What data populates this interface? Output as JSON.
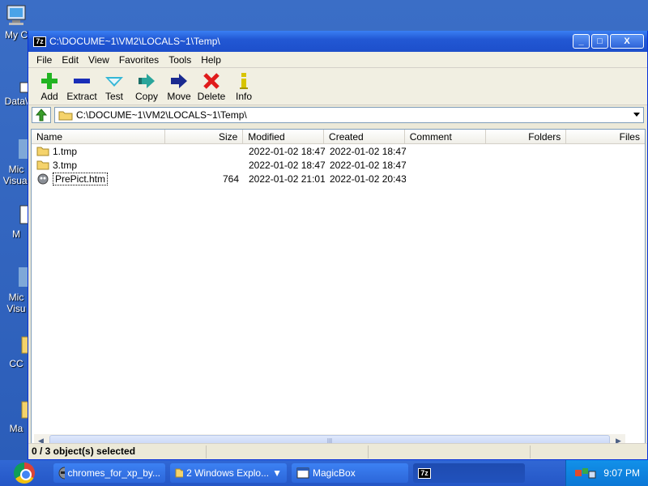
{
  "desktop_icons": [
    {
      "label": "My C"
    },
    {
      "label": "Data\\"
    },
    {
      "label": "Mic"
    },
    {
      "label": "Visual"
    },
    {
      "label": "M"
    },
    {
      "label": "Mic"
    },
    {
      "label": "Visu"
    },
    {
      "label": "CC"
    },
    {
      "label": "Ma"
    }
  ],
  "window": {
    "app_badge": "7z",
    "title": "C:\\DOCUME~1\\VM2\\LOCALS~1\\Temp\\",
    "buttons": {
      "minimize": "_",
      "maximize": "□",
      "close": "X"
    }
  },
  "menu": [
    "File",
    "Edit",
    "View",
    "Favorites",
    "Tools",
    "Help"
  ],
  "toolbar": [
    {
      "label": "Add",
      "icon": "plus-icon",
      "color": "#22b422"
    },
    {
      "label": "Extract",
      "icon": "minus-icon",
      "color": "#1a2eb8"
    },
    {
      "label": "Test",
      "icon": "check-icon",
      "color": "#35b7d6"
    },
    {
      "label": "Copy",
      "icon": "copy-arrow-icon",
      "color": "#2aa59b"
    },
    {
      "label": "Move",
      "icon": "move-arrow-icon",
      "color": "#1a2a90"
    },
    {
      "label": "Delete",
      "icon": "x-icon",
      "color": "#e01b1b"
    },
    {
      "label": "Info",
      "icon": "info-icon",
      "color": "#d8c400"
    }
  ],
  "address": {
    "path": "C:\\DOCUME~1\\VM2\\LOCALS~1\\Temp\\"
  },
  "columns": [
    "Name",
    "Size",
    "Modified",
    "Created",
    "Comment",
    "Folders",
    "Files"
  ],
  "rows": [
    {
      "name": "1.tmp",
      "type": "folder",
      "size": "",
      "modified": "2022-01-02 18:47",
      "created": "2022-01-02 18:47"
    },
    {
      "name": "3.tmp",
      "type": "folder",
      "size": "",
      "modified": "2022-01-02 18:47",
      "created": "2022-01-02 18:47"
    },
    {
      "name": "PrePict.htm",
      "type": "file",
      "size": "764",
      "modified": "2022-01-02 21:01",
      "created": "2022-01-02 20:43"
    }
  ],
  "status": {
    "selection": "0 / 3 object(s) selected"
  },
  "taskbar": {
    "tasks": [
      {
        "label": "chromes_for_xp_by..."
      },
      {
        "label": "2 Windows Explo..."
      },
      {
        "label": "MagicBox"
      },
      {
        "label": "7z"
      }
    ],
    "clock": "9:07 PM"
  }
}
